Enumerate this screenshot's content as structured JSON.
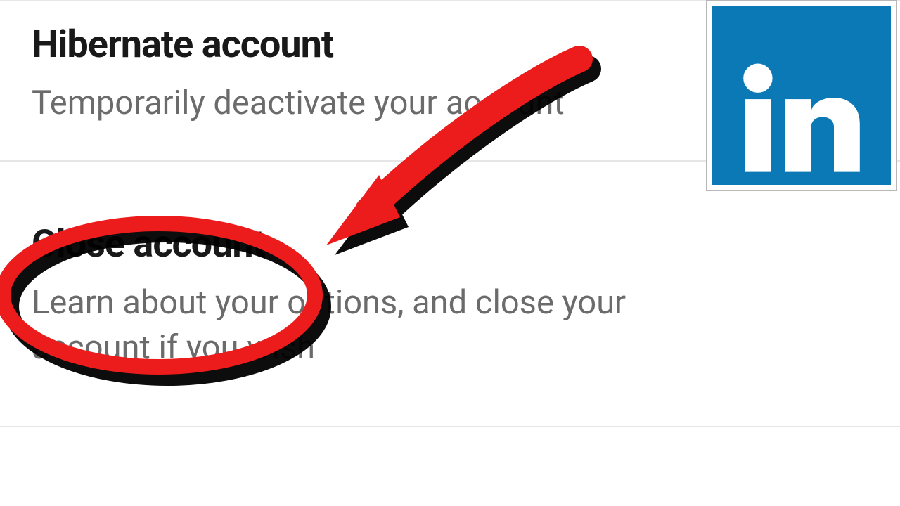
{
  "settings": {
    "hibernate": {
      "title": "Hibernate account",
      "desc": "Temporarily deactivate your account"
    },
    "close": {
      "title": "Close account",
      "desc": "Learn about your options, and close your account if you wish"
    }
  },
  "logo": {
    "name": "linkedin-icon",
    "brand_color": "#0b79b5"
  },
  "annotation": {
    "highlight_color": "#ec1c1c",
    "shadow_color": "#000000"
  }
}
